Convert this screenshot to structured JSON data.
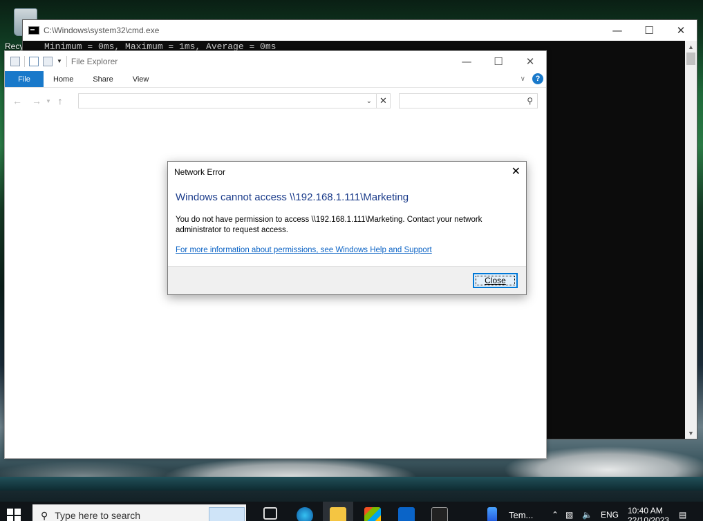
{
  "desktop": {
    "recycle_bin_label": "Recy"
  },
  "cmd": {
    "title": "C:\\Windows\\system32\\cmd.exe",
    "output_line": "Minimum = 0ms, Maximum = 1ms, Average = 0ms"
  },
  "explorer": {
    "title": "File Explorer",
    "tabs": [
      "File",
      "Home",
      "Share",
      "View"
    ],
    "address_value": "",
    "search_placeholder": ""
  },
  "dialog": {
    "title": "Network Error",
    "heading": "Windows cannot access \\\\192.168.1.111\\Marketing",
    "message": "You do not have permission to access \\\\192.168.1.111\\Marketing. Contact your network administrator to request access.",
    "link": "For more information about permissions, see Windows Help and Support",
    "close_button": "Close"
  },
  "taskbar": {
    "search_placeholder": "Type here to search",
    "running_app_label": "Tem...",
    "language": "ENG",
    "time": "10:40 AM",
    "date": "22/10/2023"
  },
  "colors": {
    "accent": "#1979ca",
    "dialog_heading": "#1a3b8a",
    "link": "#0b63c5"
  }
}
